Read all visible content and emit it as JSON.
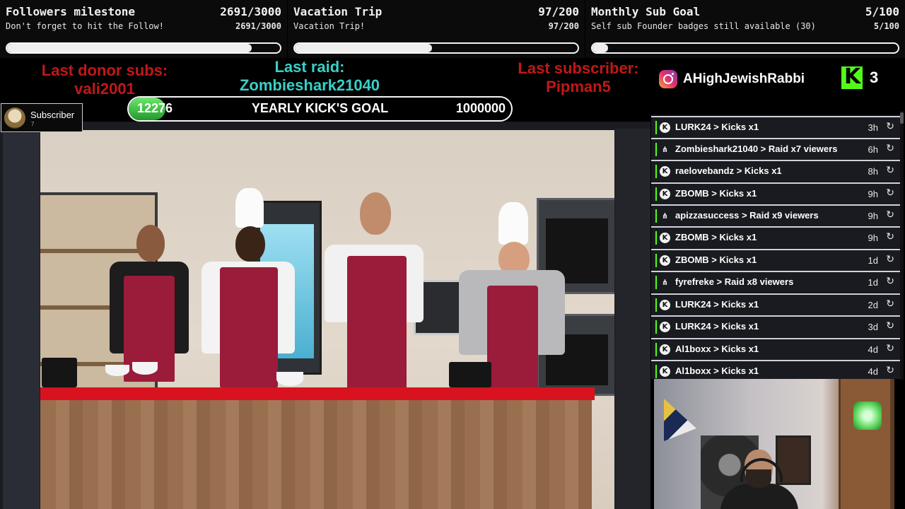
{
  "goals": [
    {
      "title": "Followers milestone",
      "count": "2691/3000",
      "subtitle": "Don't forget to hit the Follow!",
      "sub_count": "2691/3000",
      "progress": 0.897
    },
    {
      "title": "Vacation Trip",
      "count": "97/200",
      "subtitle": "Vacation Trip!",
      "sub_count": "97/200",
      "progress": 0.485
    },
    {
      "title": "Monthly Sub Goal",
      "count": "5/100",
      "subtitle": "Self sub Founder badges still available (30)",
      "sub_count": "5/100",
      "progress": 0.05
    }
  ],
  "last_donor": {
    "label": "Last donor subs:",
    "value": "vali2001"
  },
  "last_raid": {
    "label": "Last raid:",
    "value": "Zombieshark21040"
  },
  "last_subscriber": {
    "label": "Last subscriber:",
    "value": "Pipman5"
  },
  "instagram": {
    "handle": "AHighJewishRabbi",
    "icon": "instagram-icon"
  },
  "kick": {
    "count": "3",
    "logo_letter": "K",
    "color": "#53fc18"
  },
  "yearly_goal": {
    "current": "12276",
    "label": "YEARLY KICK'S GOAL",
    "target": "1000000",
    "progress": 0.012276
  },
  "subscriber_badge": {
    "label": "Subscriber",
    "small": "7"
  },
  "events": [
    {
      "type": "kicks",
      "name": "LURK24 > Kicks x1",
      "time": "3h"
    },
    {
      "type": "raid",
      "name": "Zombieshark21040 > Raid x7 viewers",
      "time": "6h"
    },
    {
      "type": "kicks",
      "name": "raelovebandz > Kicks x1",
      "time": "8h"
    },
    {
      "type": "kicks",
      "name": "ZBOMB > Kicks x1",
      "time": "9h"
    },
    {
      "type": "raid",
      "name": "apizzasuccess > Raid x9 viewers",
      "time": "9h"
    },
    {
      "type": "kicks",
      "name": "ZBOMB > Kicks x1",
      "time": "9h"
    },
    {
      "type": "kicks",
      "name": "ZBOMB > Kicks x1",
      "time": "1d"
    },
    {
      "type": "raid",
      "name": "fyrefreke > Raid x8 viewers",
      "time": "1d"
    },
    {
      "type": "kicks",
      "name": "LURK24 > Kicks x1",
      "time": "2d"
    },
    {
      "type": "kicks",
      "name": "LURK24 > Kicks x1",
      "time": "3d"
    },
    {
      "type": "kicks",
      "name": "Al1boxx > Kicks x1",
      "time": "4d"
    },
    {
      "type": "kicks",
      "name": "Al1boxx > Kicks x1",
      "time": "4d"
    }
  ],
  "colors": {
    "accent_red": "#c01818",
    "accent_teal": "#38d0c8",
    "kick_green": "#53fc18"
  }
}
